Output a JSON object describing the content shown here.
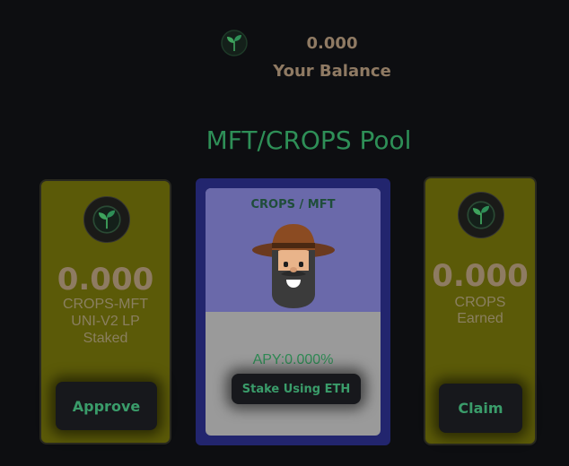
{
  "header": {
    "balance_value": "0.000",
    "balance_label": "Your Balance"
  },
  "pool": {
    "title": "MFT/CROPS Pool"
  },
  "staked_card": {
    "value": "0.000",
    "line1": "CROPS-MFT",
    "line2": "UNI-V2 LP",
    "line3": "Staked",
    "button_label": "Approve"
  },
  "stake_card": {
    "pair_label": "CROPS / MFT",
    "apy": "APY:0.000%",
    "button_label": "Stake Using ETH"
  },
  "earned_card": {
    "value": "0.000",
    "line1": "CROPS",
    "line2": "Earned",
    "button_label": "Claim"
  },
  "colors": {
    "background": "#0d0e11",
    "accent_green": "#2e8f57",
    "side_card": "#5b5a08",
    "mid_card_border": "#22256e"
  },
  "icons": {
    "logo": "sprout-leaf-icon",
    "avatar": "farmer-avatar"
  }
}
